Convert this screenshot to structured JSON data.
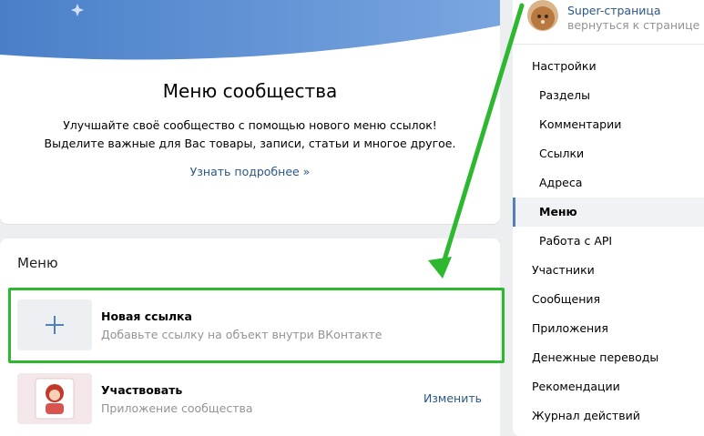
{
  "promo": {
    "title": "Меню сообщества",
    "line1": "Улучшайте своё сообщество с помощью нового меню ссылок!",
    "line2": "Выделите важные для Вас товары, записи, статьи и многое другое.",
    "link": "Узнать подробнее »"
  },
  "menu": {
    "heading": "Меню",
    "items": [
      {
        "title": "Новая ссылка",
        "subtitle": "Добавьте ссылку на объект внутри ВКонтакте",
        "icon": "plus-icon"
      },
      {
        "title": "Участвовать",
        "subtitle": "Приложение сообщества",
        "action": "Изменить",
        "icon": "app-thumbnail"
      }
    ]
  },
  "profile": {
    "name": "Super-страница",
    "back": "вернуться к странице"
  },
  "nav": {
    "items": [
      {
        "label": "Настройки",
        "level": "main"
      },
      {
        "label": "Разделы",
        "level": "sub"
      },
      {
        "label": "Комментарии",
        "level": "sub"
      },
      {
        "label": "Ссылки",
        "level": "sub"
      },
      {
        "label": "Адреса",
        "level": "sub"
      },
      {
        "label": "Меню",
        "level": "sub",
        "active": true
      },
      {
        "label": "Работа с API",
        "level": "sub"
      },
      {
        "label": "Участники",
        "level": "main"
      },
      {
        "label": "Сообщения",
        "level": "main"
      },
      {
        "label": "Приложения",
        "level": "main"
      },
      {
        "label": "Денежные переводы",
        "level": "main"
      },
      {
        "label": "Рекомендации",
        "level": "main"
      },
      {
        "label": "Журнал действий",
        "level": "main"
      }
    ]
  },
  "colors": {
    "accent_link": "#2a5885",
    "highlight_green": "#2db82f",
    "banner_blue": "#5181b8"
  }
}
